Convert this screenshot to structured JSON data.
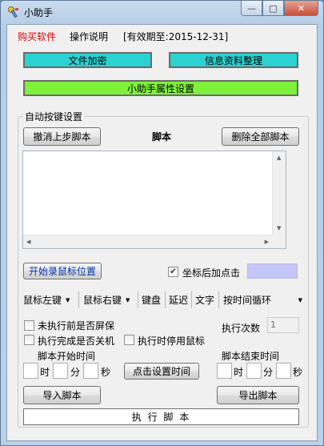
{
  "window": {
    "title": "小助手",
    "minimize": "—",
    "maximize": "□",
    "close": "✕"
  },
  "menu": {
    "buy": "购买软件",
    "help": "操作说明",
    "validity": "[有效期至:2015-12-31]"
  },
  "buttons": {
    "file_encrypt": "文件加密",
    "info_organize": "信息资料整理",
    "properties": "小助手属性设置",
    "undo_last": "撤消上步脚本",
    "script_label": "脚本",
    "delete_all": "删除全部脚本",
    "record_mouse": "开始录鼠标位置",
    "click_set_time": "点击设置时间",
    "import": "导入脚本",
    "export": "导出脚本",
    "run": "执 行 脚 本"
  },
  "group": {
    "auto_keys": "自动按键设置"
  },
  "coords": {
    "click_after_label": "坐标后加点击",
    "checked": true
  },
  "actions": {
    "mouse_left": "鼠标左键",
    "mouse_right": "鼠标右键",
    "keyboard": "键盘",
    "delay": "延迟",
    "text": "文字",
    "loop": "按时间循环"
  },
  "options": {
    "lock_screen": "未执行前是否屏保",
    "shutdown": "执行完成是否关机",
    "disable_mouse": "执行时停用鼠标",
    "exec_count_label": "执行次数",
    "exec_count_value": "1"
  },
  "schedule": {
    "start_label": "脚本开始时间",
    "end_label": "脚本结束时间",
    "hour": "时",
    "minute": "分",
    "second": "秒"
  },
  "colors": {
    "cyan": "#2bd2d2",
    "green": "#7ef23a",
    "swatch": "#c5c7fa",
    "buy_text": "#e00000"
  }
}
